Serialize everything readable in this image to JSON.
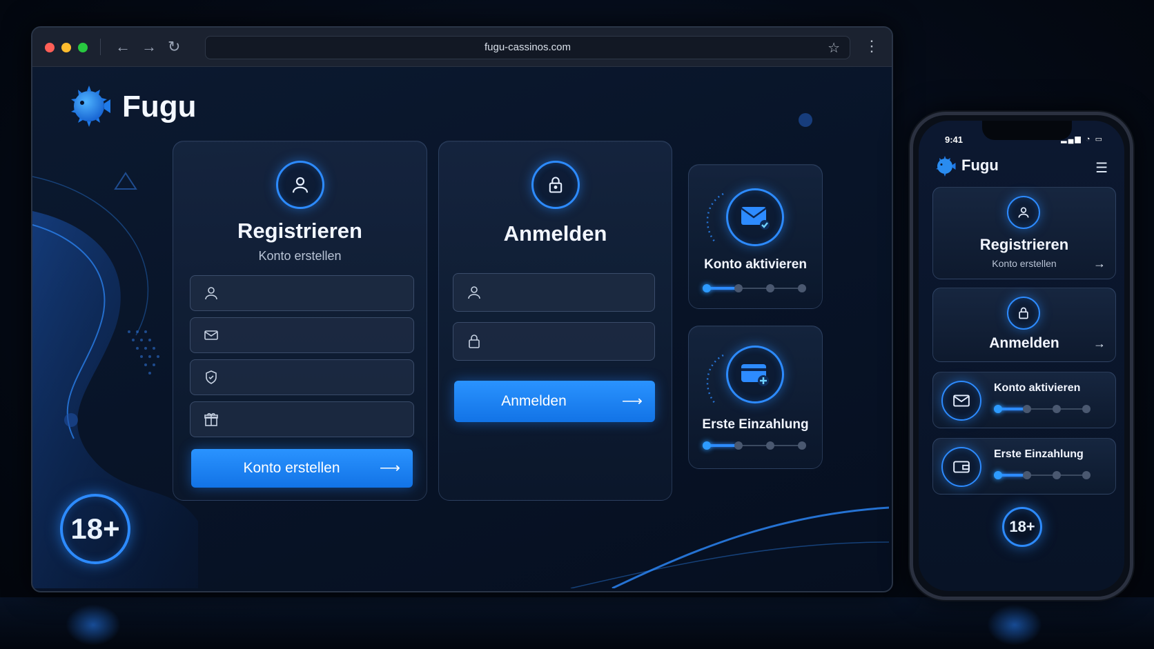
{
  "browser": {
    "url": "fugu-cassinos.com",
    "traffic_lights": {
      "close": "#ff5f57",
      "minimize": "#febc2e",
      "maximize": "#28c840"
    },
    "nav_icons": [
      "back-arrow-icon",
      "forward-arrow-icon",
      "reload-icon"
    ]
  },
  "brand": {
    "name": "Fugu",
    "logo": "pufferfish-logo"
  },
  "register_card": {
    "title": "Registrieren",
    "subtitle": "Konto erstellen",
    "icon": "user-icon",
    "fields": [
      {
        "icon": "user-icon",
        "value": ""
      },
      {
        "icon": "mail-icon",
        "value": ""
      },
      {
        "icon": "shield-icon",
        "value": ""
      },
      {
        "icon": "gift-icon",
        "value": ""
      }
    ],
    "button_label": "Konto erstellen"
  },
  "login_card": {
    "title": "Anmelden",
    "icon": "lock-icon",
    "fields": [
      {
        "icon": "user-icon",
        "value": ""
      },
      {
        "icon": "lock-icon",
        "value": ""
      }
    ],
    "button_label": "Anmelden"
  },
  "activate_card": {
    "title": "Konto aktivieren",
    "icon": "mail-check-icon",
    "progress_step": 1,
    "progress_total": 4
  },
  "deposit_card": {
    "title": "Erste Einzahlung",
    "icon": "wallet-plus-icon",
    "progress_step": 1,
    "progress_total": 4
  },
  "age_badge": "18+",
  "phone": {
    "status_time": "9:41",
    "brand_name": "Fugu",
    "menu_icon": "hamburger-icon",
    "register": {
      "title": "Registrieren",
      "subtitle": "Konto erstellen"
    },
    "login": {
      "title": "Anmelden"
    },
    "activate": {
      "title": "Konto aktivieren",
      "progress_step": 1,
      "progress_total": 4
    },
    "deposit": {
      "title": "Erste Einzahlung",
      "progress_step": 1,
      "progress_total": 4
    },
    "age_badge": "18+"
  },
  "colors": {
    "accent": "#2d8bff",
    "background": "#081428",
    "button": "#1a82f5"
  }
}
